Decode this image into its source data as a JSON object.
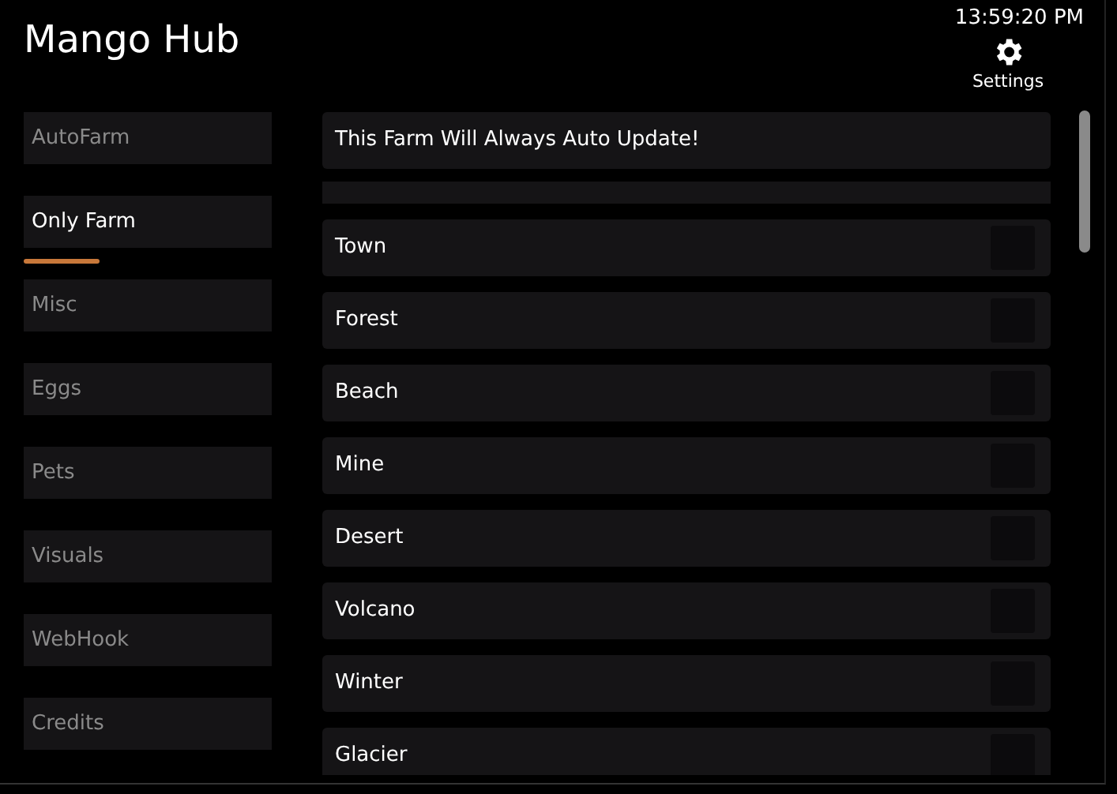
{
  "window": {
    "title": "Mango Hub",
    "clock": "13:59:20 PM",
    "settings_label": "Settings"
  },
  "sidebar": {
    "items": [
      {
        "label": "AutoFarm",
        "selected": false
      },
      {
        "label": "Only Farm",
        "selected": true
      },
      {
        "label": "Misc",
        "selected": false
      },
      {
        "label": "Eggs",
        "selected": false
      },
      {
        "label": "Pets",
        "selected": false
      },
      {
        "label": "Visuals",
        "selected": false
      },
      {
        "label": "WebHook",
        "selected": false
      },
      {
        "label": "Credits",
        "selected": false
      }
    ]
  },
  "content": {
    "notice": "This Farm Will Always Auto Update!",
    "toggles": [
      {
        "label": "Town",
        "checked": false
      },
      {
        "label": "Forest",
        "checked": false
      },
      {
        "label": "Beach",
        "checked": false
      },
      {
        "label": "Mine",
        "checked": false
      },
      {
        "label": "Desert",
        "checked": false
      },
      {
        "label": "Volcano",
        "checked": false
      },
      {
        "label": "Winter",
        "checked": false
      },
      {
        "label": "Glacier",
        "checked": false
      }
    ]
  }
}
